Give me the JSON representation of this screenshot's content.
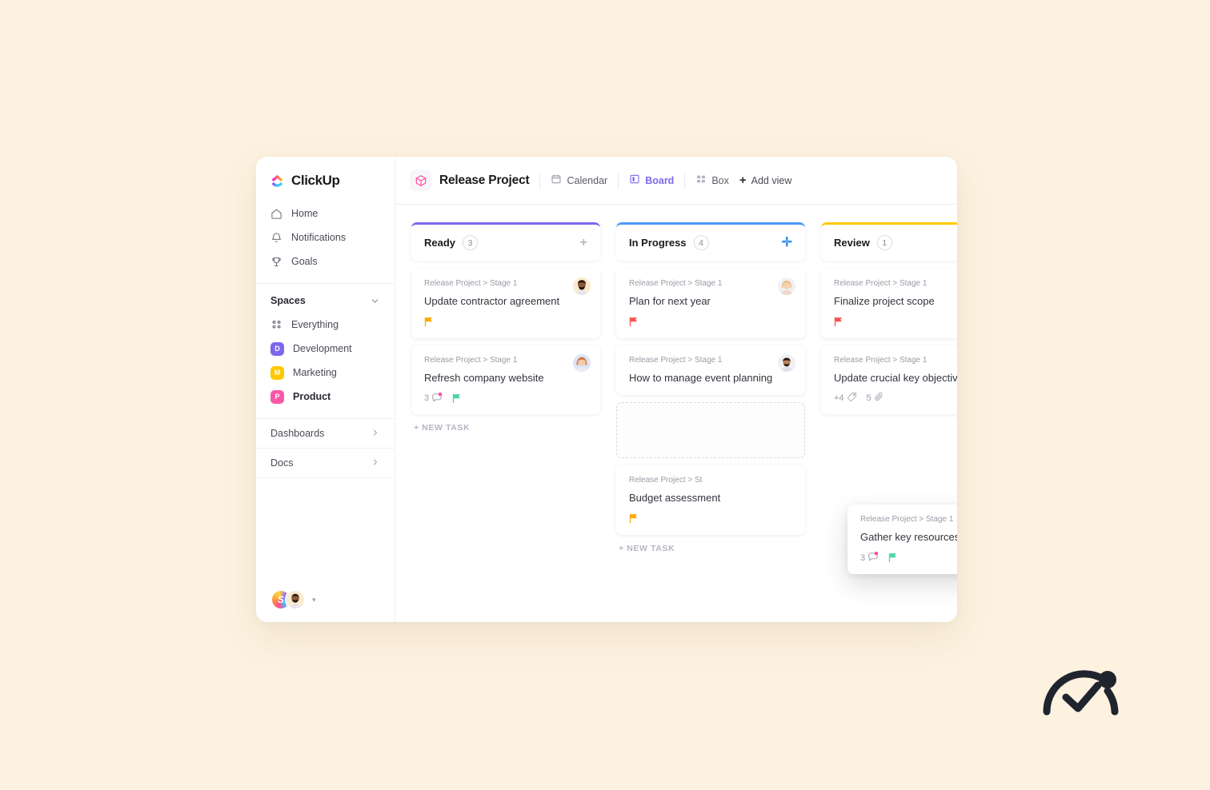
{
  "theme": {
    "page_bg": "#FDF2E0",
    "accent_purple": "#7B68EE",
    "accent_blue": "#4A9BF5",
    "accent_yellow": "#FFC800",
    "flag_orange": "#FFAB00",
    "flag_red": "#F8544E",
    "flag_green": "#4CD4A7"
  },
  "sidebar": {
    "logo_text": "ClickUp",
    "nav": [
      {
        "icon": "home-icon",
        "label": "Home"
      },
      {
        "icon": "bell-icon",
        "label": "Notifications"
      },
      {
        "icon": "trophy-icon",
        "label": "Goals"
      }
    ],
    "spaces": {
      "title": "Spaces",
      "items": [
        {
          "type": "everything",
          "label": "Everything",
          "initial": "",
          "color": ""
        },
        {
          "type": "space",
          "label": "Development",
          "initial": "D",
          "color": "#7B68EE"
        },
        {
          "type": "space",
          "label": "Marketing",
          "initial": "M",
          "color": "#FFC800"
        },
        {
          "type": "space",
          "label": "Product",
          "initial": "P",
          "color": "#F957A8",
          "active": true
        }
      ]
    },
    "bottom_links": [
      {
        "label": "Dashboards"
      },
      {
        "label": "Docs"
      }
    ],
    "user_initial": "S"
  },
  "topbar": {
    "project_icon": "cube-icon",
    "project_title": "Release Project",
    "views": [
      {
        "icon": "calendar-icon",
        "label": "Calendar",
        "active": false
      },
      {
        "icon": "board-icon",
        "label": "Board",
        "active": true
      },
      {
        "icon": "box-icon",
        "label": "Box",
        "active": false
      }
    ],
    "add_view_label": "Add view"
  },
  "board": {
    "new_task_label": "+ NEW TASK",
    "columns": [
      {
        "name": "Ready",
        "count": "3",
        "accent": "#7B68EE",
        "add_accent": false,
        "cards": [
          {
            "breadcrumb": "Release Project > Stage 1",
            "title": "Update contractor agreement",
            "avatar": "man-beard",
            "flag": "#FFAB00",
            "comments": "",
            "tags": "",
            "attachments": ""
          },
          {
            "breadcrumb": "Release Project > Stage 1",
            "title": "Refresh company website",
            "avatar": "woman-long-hair",
            "flag": "#4CD4A7",
            "comments": "3",
            "tags": "",
            "attachments": ""
          }
        ],
        "has_placeholder": false
      },
      {
        "name": "In Progress",
        "count": "4",
        "accent": "#4A9BF5",
        "add_accent": true,
        "cards": [
          {
            "breadcrumb": "Release Project > Stage 1",
            "title": "Plan for next year",
            "avatar": "woman-blonde",
            "flag": "#F8544E",
            "comments": "",
            "tags": "",
            "attachments": ""
          },
          {
            "breadcrumb": "Release Project > Stage 1",
            "title": "How to manage event planning",
            "avatar": "man-dark",
            "flag": "",
            "comments": "",
            "tags": "",
            "attachments": ""
          },
          {
            "breadcrumb": "Release Project > St",
            "title": "Budget assessment",
            "avatar": "",
            "flag": "#FFAB00",
            "comments": "",
            "tags": "",
            "attachments": ""
          }
        ],
        "has_placeholder": true
      },
      {
        "name": "Review",
        "count": "1",
        "accent": "#FFC800",
        "add_accent": false,
        "cards": [
          {
            "breadcrumb": "Release Project > Stage 1",
            "title": "Finalize project scope",
            "avatar": "",
            "flag": "#F8544E",
            "comments": "",
            "tags": "",
            "attachments": ""
          },
          {
            "breadcrumb": "Release Project > Stage 1",
            "title": "Update crucial key objectives",
            "avatar": "",
            "flag": "",
            "comments": "",
            "tags": "+4",
            "attachments": "5"
          }
        ],
        "has_placeholder": false
      }
    ],
    "dragged_card": {
      "breadcrumb": "Release Project > Stage 1",
      "title": "Gather key resources",
      "avatar": "woman-long-hair",
      "flag": "#4CD4A7",
      "comments": "3"
    }
  }
}
